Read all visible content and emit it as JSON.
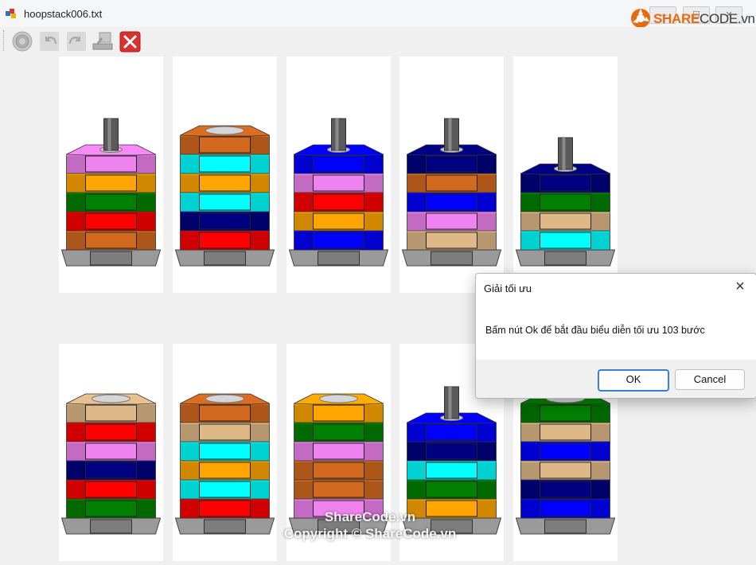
{
  "window": {
    "title": "hoopstack006.txt",
    "buttons": [
      "minimize",
      "maximize",
      "close"
    ]
  },
  "logo": {
    "brand_orange": "SHARE",
    "brand_dark": "CODE.vn"
  },
  "toolbar": {
    "items": [
      {
        "name": "target-icon",
        "enabled": false
      },
      {
        "name": "undo-icon",
        "enabled": false
      },
      {
        "name": "redo-icon",
        "enabled": false
      },
      {
        "name": "stack-icon",
        "enabled": false
      },
      {
        "name": "close-red-icon",
        "enabled": true
      }
    ]
  },
  "colors": {
    "pink": "#ee82ee",
    "orange": "#ffa500",
    "green": "#008000",
    "red": "#ff0000",
    "brown": "#d2691e",
    "cyan": "#00ffff",
    "navy": "#000080",
    "blue": "#0000ff",
    "tan": "#deb887",
    "base": "#808080",
    "pole": "#555555"
  },
  "stacks": [
    {
      "id": 1,
      "pole": true,
      "hoops": [
        "brown",
        "red",
        "green",
        "orange",
        "pink"
      ]
    },
    {
      "id": 2,
      "pole": false,
      "hoops": [
        "red",
        "navy",
        "cyan",
        "orange",
        "cyan",
        "brown"
      ]
    },
    {
      "id": 3,
      "pole": true,
      "hoops": [
        "blue",
        "orange",
        "red",
        "pink",
        "blue"
      ]
    },
    {
      "id": 4,
      "pole": true,
      "hoops": [
        "tan",
        "pink",
        "blue",
        "brown",
        "navy"
      ]
    },
    {
      "id": 5,
      "pole": true,
      "hoops": [
        "cyan",
        "tan",
        "green",
        "navy"
      ]
    },
    {
      "id": 6,
      "pole": false,
      "hoops": [
        "green",
        "red",
        "navy",
        "pink",
        "red",
        "tan"
      ]
    },
    {
      "id": 7,
      "pole": false,
      "hoops": [
        "red",
        "cyan",
        "orange",
        "cyan",
        "tan",
        "brown"
      ]
    },
    {
      "id": 8,
      "pole": false,
      "hoops": [
        "pink",
        "brown",
        "brown",
        "pink",
        "green",
        "orange"
      ]
    },
    {
      "id": 9,
      "pole": true,
      "hoops": [
        "orange",
        "green",
        "cyan",
        "navy",
        "blue"
      ]
    },
    {
      "id": 10,
      "pole": false,
      "hoops": [
        "blue",
        "navy",
        "tan",
        "blue",
        "tan",
        "green"
      ]
    }
  ],
  "dialog": {
    "title": "Giải tối ưu",
    "message": "Bấm nút Ok để bắt đầu biểu diễn tối ưu 103 bước",
    "ok_label": "OK",
    "cancel_label": "Cancel"
  },
  "watermark": {
    "line1": "ShareCode.vn",
    "line2": "Copyright © ShareCode.vn"
  }
}
